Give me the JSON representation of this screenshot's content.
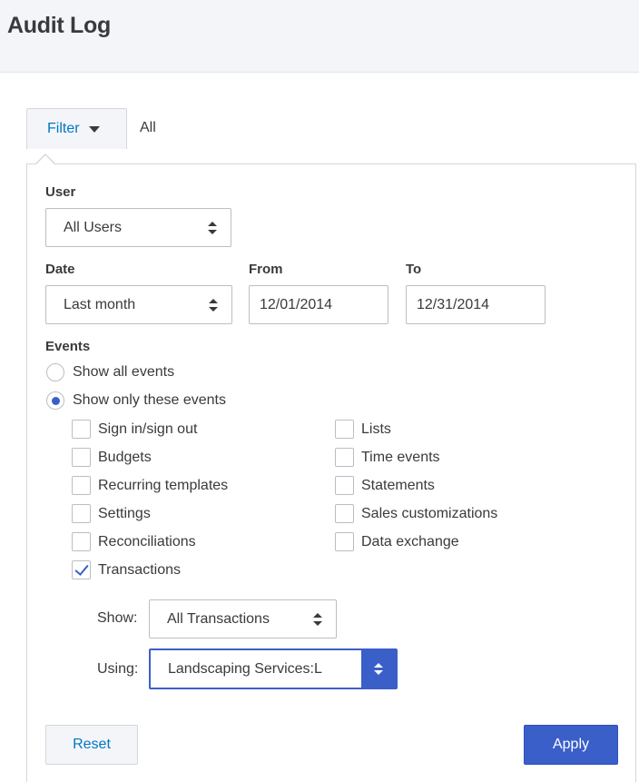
{
  "header": {
    "title": "Audit Log"
  },
  "filter": {
    "button_label": "Filter",
    "summary": "All"
  },
  "user": {
    "label": "User",
    "selected": "All Users"
  },
  "date": {
    "label": "Date",
    "selected": "Last month",
    "from_label": "From",
    "from_value": "12/01/2014",
    "to_label": "To",
    "to_value": "12/31/2014"
  },
  "events": {
    "label": "Events",
    "options": [
      {
        "label": "Show all events",
        "checked": false
      },
      {
        "label": "Show only these events",
        "checked": true
      }
    ],
    "left_items": [
      {
        "label": "Sign in/sign out",
        "checked": false
      },
      {
        "label": "Budgets",
        "checked": false
      },
      {
        "label": "Recurring templates",
        "checked": false
      },
      {
        "label": "Settings",
        "checked": false
      },
      {
        "label": "Reconciliations",
        "checked": false
      },
      {
        "label": "Transactions",
        "checked": true
      }
    ],
    "right_items": [
      {
        "label": "Lists",
        "checked": false
      },
      {
        "label": "Time events",
        "checked": false
      },
      {
        "label": "Statements",
        "checked": false
      },
      {
        "label": "Sales customizations",
        "checked": false
      },
      {
        "label": "Data exchange",
        "checked": false
      }
    ]
  },
  "transactions": {
    "show_label": "Show:",
    "show_selected": "All Transactions",
    "using_label": "Using:",
    "using_selected": "Landscaping Services:L"
  },
  "actions": {
    "reset_label": "Reset",
    "apply_label": "Apply"
  },
  "colors": {
    "accent": "#3b5fc9",
    "link": "#0077c5",
    "text": "#393a3d",
    "header_bg": "#f4f5f8"
  }
}
